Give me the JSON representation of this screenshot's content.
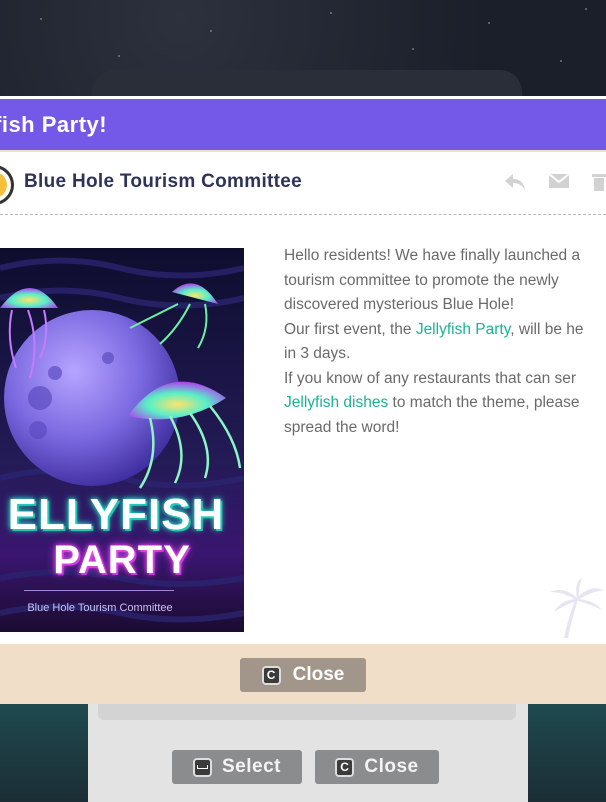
{
  "dialog": {
    "title": "fish Party!",
    "sender": "Blue Hole Tourism Committee",
    "message": [
      {
        "text": "Hello residents! We have finally launched a\ntourism committee to promote the newly\ndiscovered mysterious Blue Hole!\nOur first event, the ",
        "highlight": false
      },
      {
        "text": "Jellyfish Party",
        "highlight": true
      },
      {
        "text": ", will be he\nin 3 days.\nIf you know of any restaurants that can ser\n",
        "highlight": false
      },
      {
        "text": "Jellyfish dishes",
        "highlight": true
      },
      {
        "text": " to match the theme, please\nspread the word!",
        "highlight": false
      }
    ],
    "poster": {
      "title_line1": "ELLYFISH",
      "title_line2": "PARTY",
      "subtitle": "Blue Hole Tourism Committee"
    },
    "close_button": {
      "key": "C",
      "label": "Close"
    },
    "icons": [
      "reply-icon",
      "mail-icon",
      "trash-icon"
    ]
  },
  "background_hints": {
    "select": {
      "key": "space",
      "label": "Select"
    },
    "close": {
      "key": "C",
      "label": "Close"
    }
  },
  "colors": {
    "title_bar": "#7458e8",
    "highlight": "#1bb396",
    "dialog_footer": "#f0dec8",
    "close_button": "#a2958a"
  }
}
